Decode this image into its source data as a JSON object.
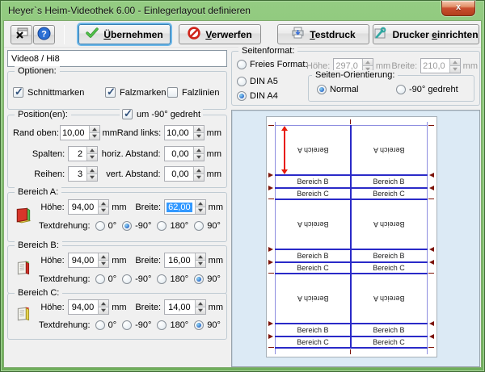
{
  "window": {
    "title": "Heyer`s Heim-Videothek 6.00 - Einlegerlayout definieren",
    "close_glyph": "x"
  },
  "unit_mm": "mm",
  "toolbar": {
    "apply": {
      "pre": "",
      "accel": "Ü",
      "rest": "bernehmen"
    },
    "discard": {
      "pre": "",
      "accel": "V",
      "rest": "erwerfen"
    },
    "testprint": {
      "pre": "",
      "accel": "T",
      "rest": "estdruck"
    },
    "printer_setup": {
      "pre": "Drucker ",
      "accel": "e",
      "rest": "inrichten"
    }
  },
  "left": {
    "layout_name": "Video8 / Hi8",
    "optionen": {
      "legend": "Optionen:",
      "items": [
        {
          "label": "Schnittmarken",
          "checked": true
        },
        {
          "label": "Falzmarken",
          "checked": true
        },
        {
          "label": "Falzlinien",
          "checked": false
        }
      ]
    },
    "position": {
      "legend": "Position(en):",
      "rotated_checkbox": {
        "label": "um -90° gedreht",
        "checked": true
      },
      "rand_oben": {
        "label": "Rand oben:",
        "value": "10,00"
      },
      "rand_links": {
        "label": "Rand links:",
        "value": "10,00"
      },
      "spalten": {
        "label": "Spalten:",
        "value": "2"
      },
      "horiz": {
        "label": "horiz. Abstand:",
        "value": "0,00"
      },
      "reihen": {
        "label": "Reihen:",
        "value": "3"
      },
      "vert": {
        "label": "vert. Abstand:",
        "value": "0,00"
      }
    },
    "bereich_a": {
      "legend": "Bereich A:",
      "hoehe_label": "Höhe:",
      "hoehe": "94,00",
      "breite_label": "Breite:",
      "breite": "62,00",
      "breite_selected": true,
      "textdrehung_label": "Textdrehung:",
      "options": [
        {
          "label": "0°",
          "checked": false
        },
        {
          "label": "-90°",
          "checked": true
        },
        {
          "label": "180°",
          "checked": false
        },
        {
          "label": "90°",
          "checked": false
        }
      ]
    },
    "bereich_b": {
      "legend": "Bereich B:",
      "hoehe_label": "Höhe:",
      "hoehe": "94,00",
      "breite_label": "Breite:",
      "breite": "16,00",
      "breite_selected": false,
      "textdrehung_label": "Textdrehung:",
      "options": [
        {
          "label": "0°",
          "checked": false
        },
        {
          "label": "-90°",
          "checked": false
        },
        {
          "label": "180°",
          "checked": false
        },
        {
          "label": "90°",
          "checked": true
        }
      ]
    },
    "bereich_c": {
      "legend": "Bereich C:",
      "hoehe_label": "Höhe:",
      "hoehe": "94,00",
      "breite_label": "Breite:",
      "breite": "14,00",
      "breite_selected": false,
      "textdrehung_label": "Textdrehung:",
      "options": [
        {
          "label": "0°",
          "checked": false
        },
        {
          "label": "-90°",
          "checked": false
        },
        {
          "label": "180°",
          "checked": false
        },
        {
          "label": "90°",
          "checked": true
        }
      ]
    }
  },
  "seitenformat": {
    "legend": "Seitenformat:",
    "freies": {
      "label": "Freies Format:",
      "checked": false
    },
    "hoehe_label": "Höhe:",
    "hoehe": "297,0",
    "breite_label": "Breite:",
    "breite": "210,0",
    "din_a5": {
      "label": "DIN A5",
      "checked": false
    },
    "din_a4": {
      "label": "DIN A4",
      "checked": true
    },
    "orientierung": {
      "legend": "Seiten-Orientierung:",
      "normal": {
        "label": "Normal",
        "checked": true
      },
      "rotated": {
        "label": "-90° gedreht",
        "checked": false
      }
    }
  },
  "preview": {
    "area_a": "Bereich A",
    "area_b": "Bereich B",
    "area_c": "Bereich C"
  },
  "colors": {
    "titlebar_green": "#94cc82",
    "border_green": "#6fae5b",
    "close_red": "#c94f30",
    "selection_blue": "#3399ff",
    "preview_bg": "#dceaf5",
    "page_white": "#ffffff",
    "line_blue": "#2a2ac8",
    "line_lavender": "#8f8fe0",
    "mark_dark_red": "#7d1408",
    "measure_red": "#e81c0c"
  }
}
